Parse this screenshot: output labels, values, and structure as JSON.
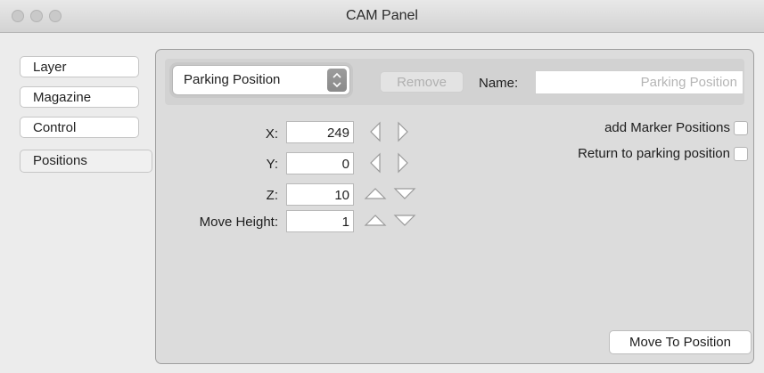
{
  "window": {
    "title": "CAM Panel"
  },
  "sidebar": {
    "items": [
      {
        "label": "Layer"
      },
      {
        "label": "Magazine"
      },
      {
        "label": "Control"
      },
      {
        "label": "Positions"
      }
    ]
  },
  "toolbar": {
    "position_select": "Parking Position",
    "remove_label": "Remove",
    "name_label": "Name:",
    "name_placeholder": "Parking Position"
  },
  "coords": {
    "x": {
      "label": "X:",
      "value": "249"
    },
    "y": {
      "label": "Y:",
      "value": "0"
    },
    "z": {
      "label": "Z:",
      "value": "10"
    },
    "move_height": {
      "label": "Move Height:",
      "value": "1"
    }
  },
  "options": {
    "add_marker": "add Marker Positions",
    "return_parking": "Return to parking position"
  },
  "actions": {
    "move_to_position": "Move To Position"
  }
}
